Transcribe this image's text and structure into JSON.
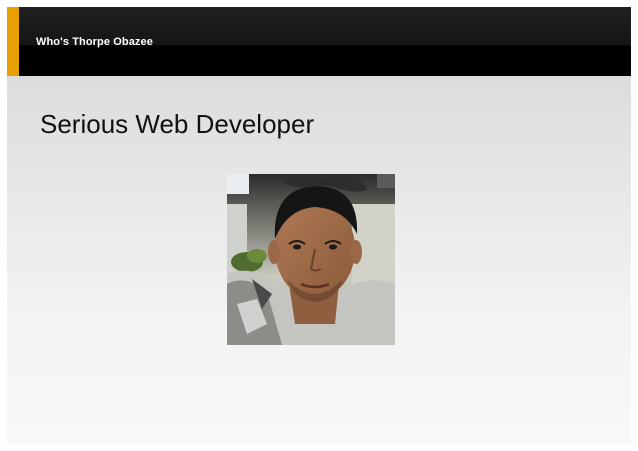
{
  "header": {
    "title": "Who's Thorpe Obazee",
    "accent_color": "#e8a000",
    "bar_color": "#000000"
  },
  "slide": {
    "heading": "Serious Web Developer"
  },
  "photo": {
    "alt": "portrait-photo"
  }
}
